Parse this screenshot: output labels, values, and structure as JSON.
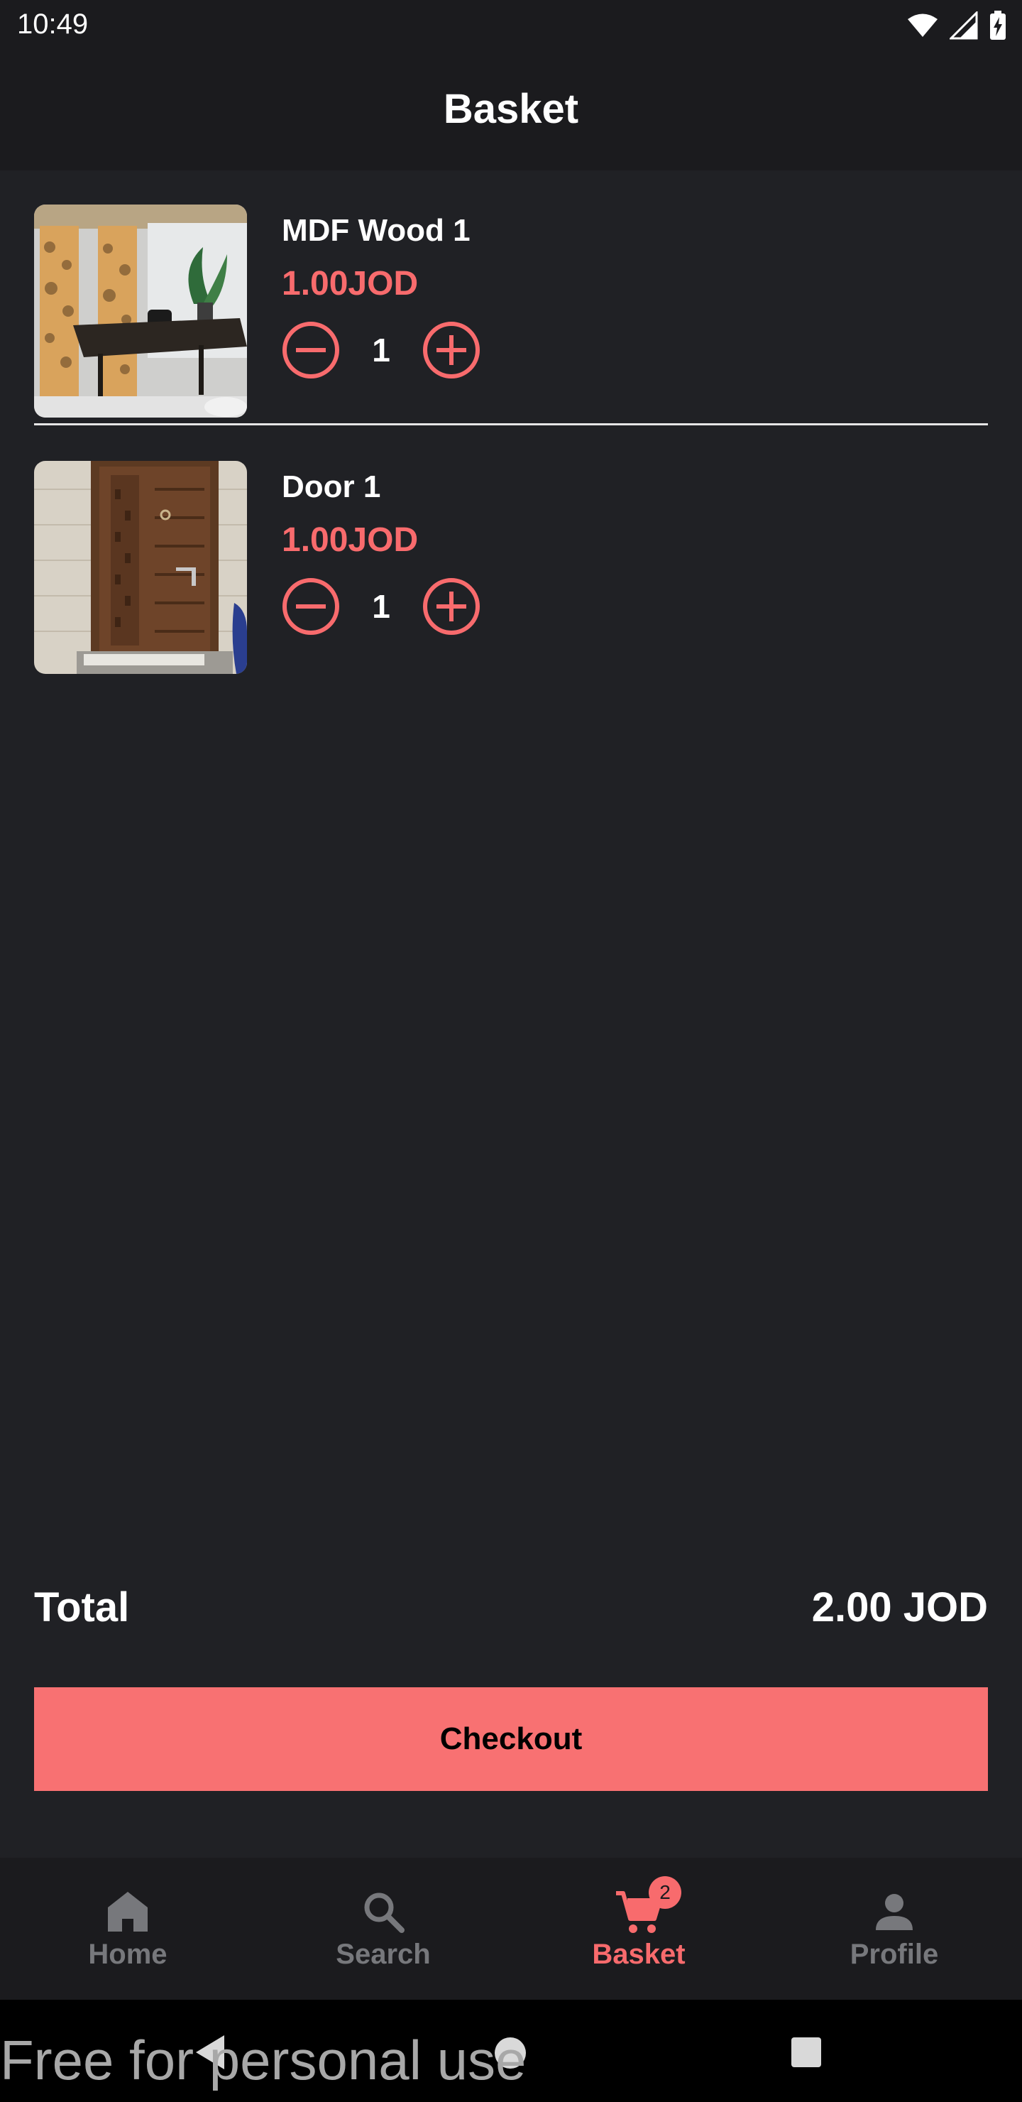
{
  "status_bar": {
    "time": "10:49",
    "icons": [
      "wifi-icon",
      "cellular-signal-icon",
      "battery-charging-icon"
    ]
  },
  "app_bar": {
    "title": "Basket"
  },
  "basket": {
    "items": [
      {
        "name": "MDF Wood 1",
        "price": "1.00JOD",
        "quantity": "1",
        "image": "Office room with laser-cut MDF panels, desk and plant"
      },
      {
        "name": "Door 1",
        "price": "1.00JOD",
        "quantity": "1",
        "image": "Brown wooden apartment door"
      }
    ]
  },
  "summary": {
    "total_label": "Total",
    "total_value": "2.00 JOD"
  },
  "checkout": {
    "label": "Checkout"
  },
  "bottom_nav": {
    "items": [
      {
        "label": "Home",
        "icon": "home-icon",
        "active": false
      },
      {
        "label": "Search",
        "icon": "search-icon",
        "active": false
      },
      {
        "label": "Basket",
        "icon": "cart-icon",
        "active": true,
        "badge": "2"
      },
      {
        "label": "Profile",
        "icon": "person-icon",
        "active": false
      }
    ]
  },
  "system_nav": {
    "buttons": [
      "back-icon",
      "home-circle-icon",
      "recents-square-icon"
    ]
  },
  "watermark": {
    "text": "Free for personal use"
  },
  "colors": {
    "accent": "#f86b6d",
    "checkout": "#f87172",
    "background": "#202125",
    "bar": "#1b1b1e",
    "inactive_nav": "#77787c"
  }
}
